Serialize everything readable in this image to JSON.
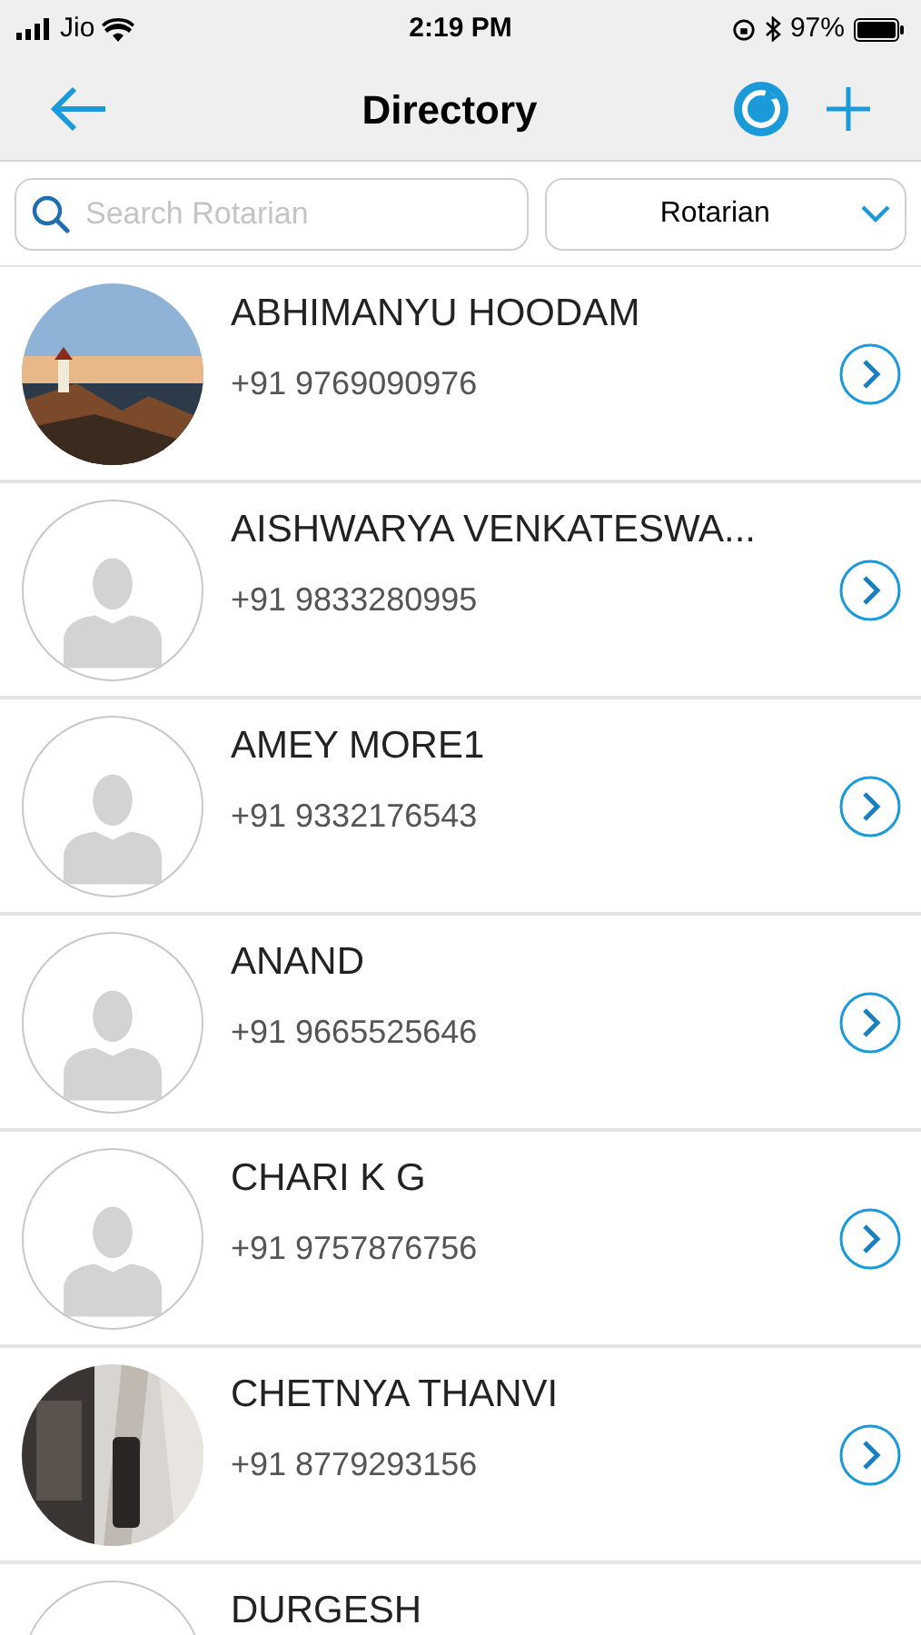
{
  "status_bar": {
    "carrier": "Jio",
    "time": "2:19 PM",
    "battery": "97%"
  },
  "header": {
    "title": "Directory"
  },
  "search": {
    "placeholder": "Search Rotarian"
  },
  "filter": {
    "value": "Rotarian"
  },
  "contacts": [
    {
      "name": "ABHIMANYU HOODAM",
      "phone": "+91 9769090976",
      "kind": "picture"
    },
    {
      "name": "AISHWARYA VENKATESWA...",
      "phone": "+91 9833280995",
      "kind": "placeholder"
    },
    {
      "name": "AMEY MORE1",
      "phone": "+91 9332176543",
      "kind": "placeholder"
    },
    {
      "name": "ANAND",
      "phone": "+91 9665525646",
      "kind": "placeholder"
    },
    {
      "name": "CHARI K G",
      "phone": "+91 9757876756",
      "kind": "placeholder"
    },
    {
      "name": "CHETNYA THANVI",
      "phone": "+91 8779293156",
      "kind": "picture"
    },
    {
      "name": "DURGESH",
      "kind": "placeholder"
    }
  ]
}
